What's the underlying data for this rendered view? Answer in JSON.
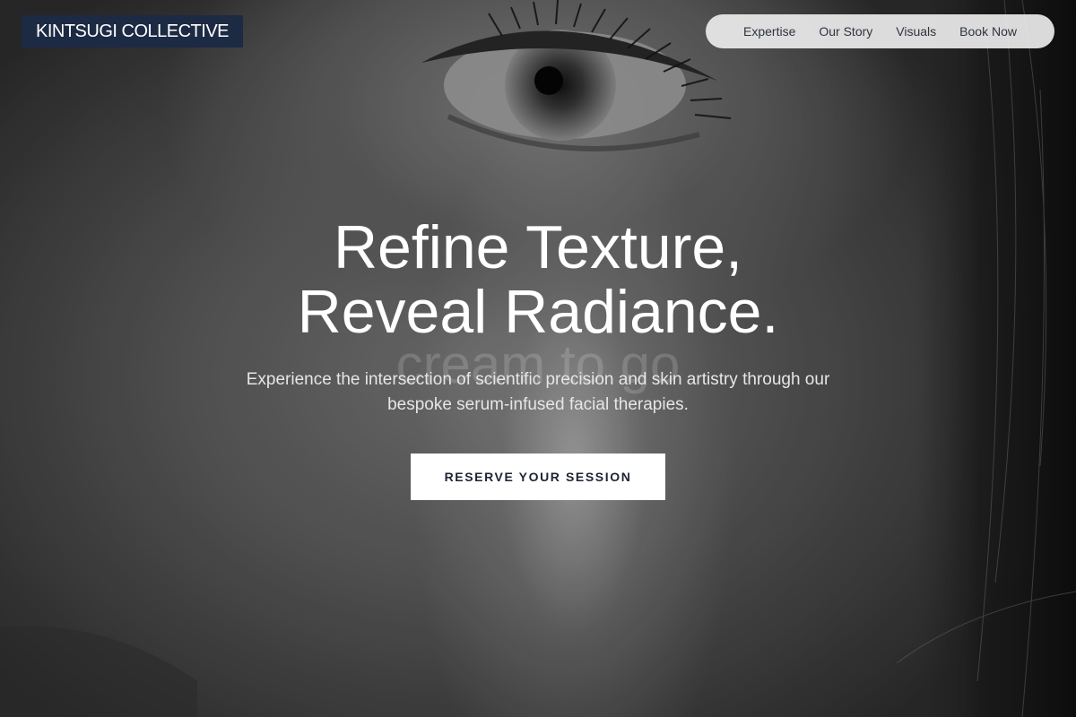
{
  "brand": {
    "name": "KINTSUGI COLLECTIVE",
    "color": "#1d2a44"
  },
  "nav": {
    "items": [
      {
        "label": "Expertise"
      },
      {
        "label": "Our Story"
      },
      {
        "label": "Visuals"
      },
      {
        "label": "Book Now"
      }
    ]
  },
  "hero": {
    "headline_line1": "Refine Texture,",
    "headline_line2": "Reveal Radiance.",
    "background_watermark": "cream to go",
    "subtitle": "Experience the intersection of scientific precision and skin artistry through our bespoke serum-infused facial therapies.",
    "cta_label": "RESERVE YOUR SESSION"
  }
}
